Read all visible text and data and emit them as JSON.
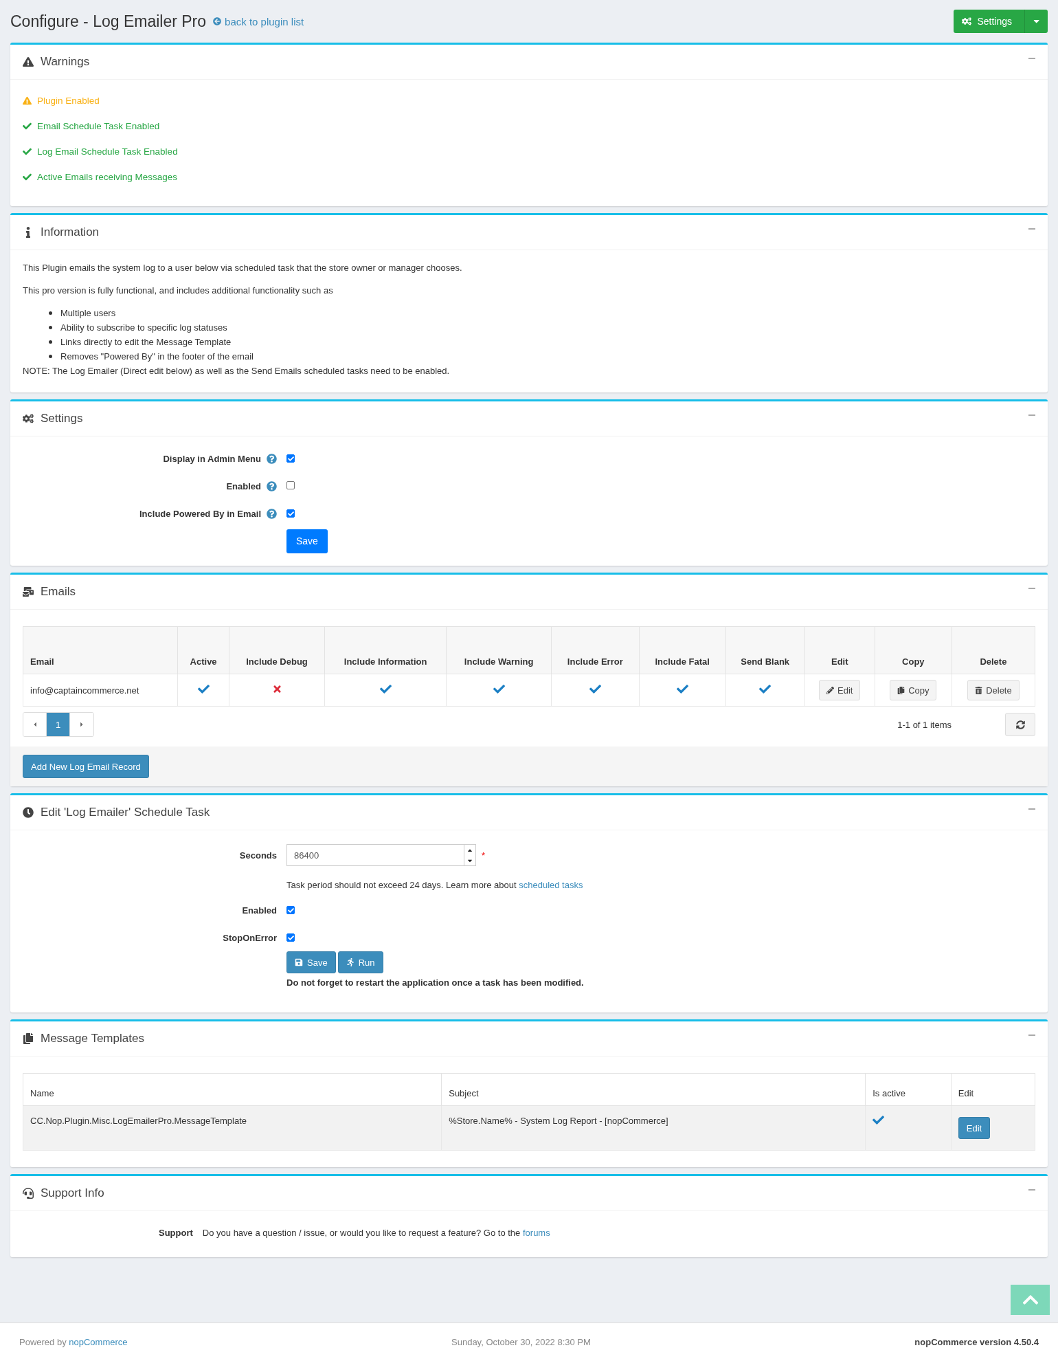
{
  "page": {
    "title": "Configure - Log Emailer Pro",
    "back_link": "back to plugin list",
    "settings_button": "Settings"
  },
  "warnings": {
    "title": "Warnings",
    "items": [
      {
        "kind": "warning",
        "text": "Plugin Enabled"
      },
      {
        "kind": "ok",
        "text": "Email Schedule Task Enabled"
      },
      {
        "kind": "ok",
        "text": "Log Email Schedule Task Enabled"
      },
      {
        "kind": "ok",
        "text": "Active Emails receiving Messages"
      }
    ]
  },
  "information": {
    "title": "Information",
    "paragraphs": [
      "This Plugin emails the system log to a user below via scheduled task that the store owner or manager chooses.",
      "This pro version is fully functional, and includes additional functionality such as"
    ],
    "bullets": [
      "Multiple users",
      "Ability to subscribe to specific log statuses",
      "Links directly to edit the Message Template",
      "Removes \"Powered By\" in the footer of the email"
    ],
    "note": "NOTE: The Log Emailer (Direct edit below) as well as the Send Emails scheduled tasks need to be enabled."
  },
  "settings": {
    "title": "Settings",
    "fields": [
      {
        "label": "Display in Admin Menu",
        "checked": true
      },
      {
        "label": "Enabled",
        "checked": false
      },
      {
        "label": "Include Powered By in Email",
        "checked": true
      }
    ],
    "save": "Save"
  },
  "emails": {
    "title": "Emails",
    "columns": [
      "Email",
      "Active",
      "Include Debug",
      "Include Information",
      "Include Warning",
      "Include Error",
      "Include Fatal",
      "Send Blank",
      "Edit",
      "Copy",
      "Delete"
    ],
    "rows": [
      {
        "email": "info@captaincommerce.net",
        "flags": [
          true,
          false,
          true,
          true,
          true,
          true,
          true
        ],
        "edit": "Edit",
        "copy": "Copy",
        "delete": "Delete"
      }
    ],
    "pages": [
      {
        "label": "1",
        "selected": true
      }
    ],
    "summary": "1-1 of 1 items",
    "add_button": "Add New Log Email Record"
  },
  "schedule": {
    "title": "Edit 'Log Emailer' Schedule Task",
    "seconds_label": "Seconds",
    "seconds_value": "86400",
    "required": "*",
    "hint": "Task period should not exceed 24 days. Learn more about",
    "hint_link": "scheduled tasks",
    "checks": [
      {
        "label": "Enabled",
        "checked": true
      },
      {
        "label": "StopOnError",
        "checked": true
      }
    ],
    "save": "Save",
    "run": "Run",
    "note": "Do not forget to restart the application once a task has been modified."
  },
  "message_templates": {
    "title": "Message Templates",
    "columns": [
      "Name",
      "Subject",
      "Is active",
      "Edit"
    ],
    "rows": [
      {
        "name": "CC.Nop.Plugin.Misc.LogEmailerPro.MessageTemplate",
        "subject": "%Store.Name% - System Log Report - [nopCommerce]",
        "active": true,
        "edit": "Edit"
      }
    ]
  },
  "support": {
    "title": "Support Info",
    "label": "Support",
    "text": "Do you have a question / issue, or would you like to request a feature? Go to the",
    "link": "forums"
  },
  "footer": {
    "powered_by": "Powered by",
    "powered_link": "nopCommerce",
    "date": "Sunday, October 30, 2022 8:30 PM",
    "version": "nopCommerce version 4.50.4"
  }
}
